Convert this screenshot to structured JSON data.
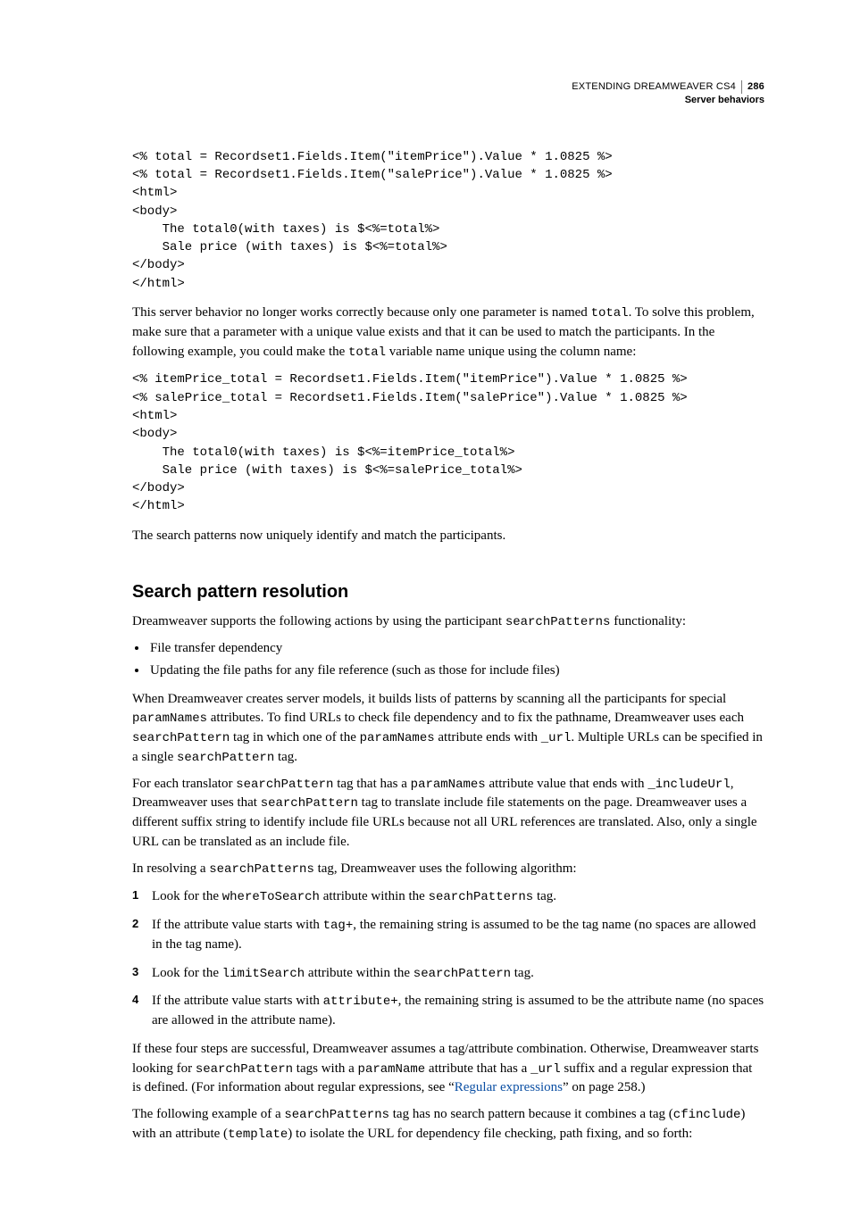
{
  "header": {
    "title": "EXTENDING DREAMWEAVER CS4",
    "section": "Server behaviors",
    "page": "286"
  },
  "code1": "<% total = Recordset1.Fields.Item(\"itemPrice\").Value * 1.0825 %>\n<% total = Recordset1.Fields.Item(\"salePrice\").Value * 1.0825 %>\n<html>\n<body>\n    The total0(with taxes) is $<%=total%>\n    Sale price (with taxes) is $<%=total%>\n</body>\n</html>",
  "para1_a": "This server behavior no longer works correctly because only one parameter is named ",
  "para1_code": "total",
  "para1_b": ". To solve this problem, make sure that a parameter with a unique value exists and that it can be used to match the participants. In the following example, you could make the ",
  "para1_code2": "total",
  "para1_c": " variable name unique using the column name:",
  "code2": "<% itemPrice_total = Recordset1.Fields.Item(\"itemPrice\").Value * 1.0825 %>\n<% salePrice_total = Recordset1.Fields.Item(\"salePrice\").Value * 1.0825 %>\n<html>\n<body>\n    The total0(with taxes) is $<%=itemPrice_total%>\n    Sale price (with taxes) is $<%=salePrice_total%>\n</body>\n</html>",
  "para2": "The search patterns now uniquely identify and match the participants.",
  "heading1": "Search pattern resolution",
  "para3_a": "Dreamweaver supports the following actions by using the participant ",
  "para3_code": "searchPatterns",
  "para3_b": " functionality:",
  "bullet1": "File transfer dependency",
  "bullet2": "Updating the file paths for any file reference (such as those for include files)",
  "para4_a": "When Dreamweaver creates server models, it builds lists of patterns by scanning all the participants for special ",
  "para4_code1": "paramNames",
  "para4_b": " attributes. To find URLs to check file dependency and to fix the pathname, Dreamweaver uses each ",
  "para4_code2": "searchPattern",
  "para4_c": " tag in which one of the ",
  "para4_code3": "paramNames",
  "para4_d": " attribute ends with ",
  "para4_code4": "_url",
  "para4_e": ". Multiple URLs can be specified in a single ",
  "para4_code5": "searchPattern",
  "para4_f": " tag.",
  "para5_a": "For each translator ",
  "para5_code1": "searchPattern",
  "para5_b": " tag that has a ",
  "para5_code2": "paramNames",
  "para5_c": " attribute value that ends with ",
  "para5_code3": "_includeUrl",
  "para5_d": ", Dreamweaver uses that ",
  "para5_code4": "searchPattern",
  "para5_e": " tag to translate include file statements on the page. Dreamweaver uses a different suffix string to identify include file URLs because not all URL references are translated. Also, only a single URL can be translated as an include file.",
  "para6_a": "In resolving a ",
  "para6_code": "searchPatterns",
  "para6_b": " tag, Dreamweaver uses the following algorithm:",
  "step1_a": "Look for the ",
  "step1_code1": "whereToSearch",
  "step1_b": " attribute within the ",
  "step1_code2": "searchPatterns",
  "step1_c": " tag.",
  "step2_a": "If the attribute value starts with ",
  "step2_code": "tag+",
  "step2_b": ", the remaining string is assumed to be the tag name (no spaces are allowed in the tag name).",
  "step3_a": "Look for the ",
  "step3_code1": "limitSearch",
  "step3_b": " attribute within the ",
  "step3_code2": "searchPattern",
  "step3_c": " tag.",
  "step4_a": "If the attribute value starts with ",
  "step4_code": "attribute+",
  "step4_b": ", the remaining string is assumed to be the attribute name (no spaces are allowed in the attribute name).",
  "para7_a": "If these four steps are successful, Dreamweaver assumes a tag/attribute combination. Otherwise, Dreamweaver starts looking for ",
  "para7_code1": "searchPattern",
  "para7_b": " tags with a ",
  "para7_code2": "paramName",
  "para7_c": " attribute that has a ",
  "para7_code3": "_url",
  "para7_d": " suffix and a regular expression that is defined. (For information about regular expressions, see “",
  "para7_link": "Regular expressions",
  "para7_e": "” on page 258.)",
  "para8_a": "The following example of a ",
  "para8_code1": "searchPatterns",
  "para8_b": " tag has no search pattern because it combines a tag (",
  "para8_code2": "cfinclude",
  "para8_c": ") with an attribute (",
  "para8_code3": "template",
  "para8_d": ") to isolate the URL for dependency file checking, path fixing, and so forth:"
}
